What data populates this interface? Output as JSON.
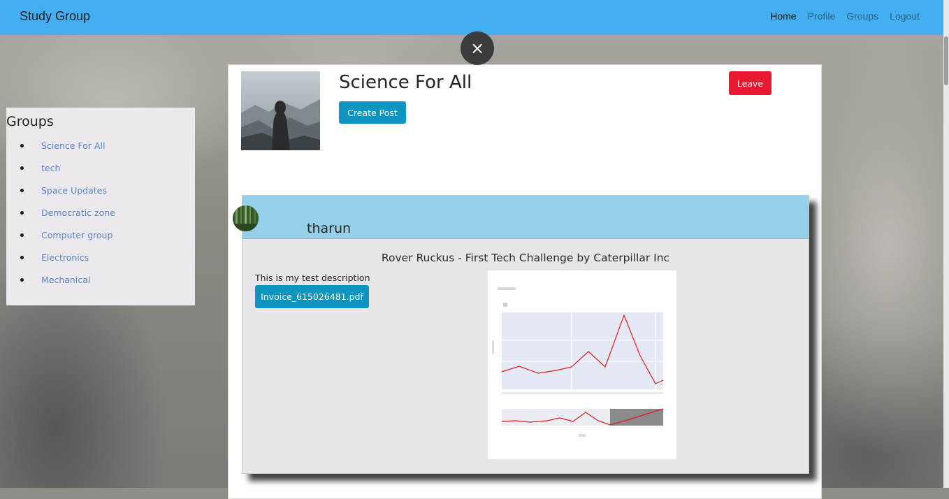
{
  "navbar": {
    "brand": "Study Group",
    "links": [
      {
        "label": "Home",
        "active": true
      },
      {
        "label": "Profile",
        "active": false
      },
      {
        "label": "Groups",
        "active": false
      },
      {
        "label": "Logout",
        "active": false
      }
    ],
    "color": "#44aff0"
  },
  "sidebar": {
    "title": "Groups",
    "items": [
      {
        "label": "Science For All"
      },
      {
        "label": "tech"
      },
      {
        "label": "Space Updates"
      },
      {
        "label": "Democratic zone"
      },
      {
        "label": "Computer group"
      },
      {
        "label": "Electronics"
      },
      {
        "label": "Mechanical"
      }
    ]
  },
  "modal": {
    "close_icon": "×",
    "group_title": "Science For All",
    "create_post_label": "Create Post",
    "leave_label": "Leave",
    "leave_color": "#e8192e",
    "primary_color": "#0e94c0"
  },
  "post": {
    "author": "tharun",
    "title": "Rover Ruckus - First Tech Challenge by Caterpillar Inc",
    "description": "This is my test description",
    "attachment_label": "Invoice_615026481.pdf"
  }
}
